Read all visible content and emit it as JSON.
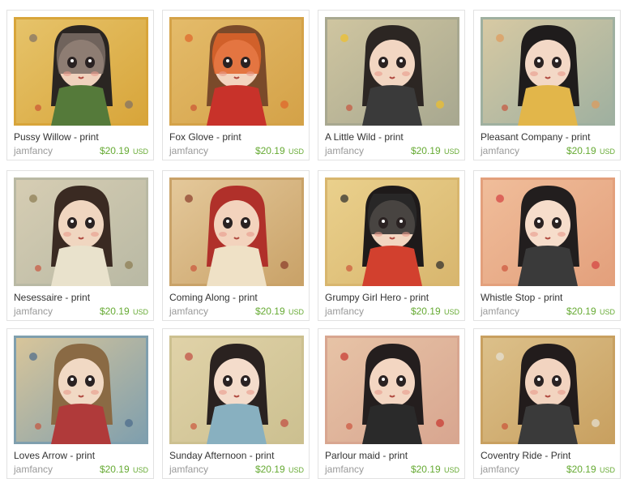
{
  "listings": [
    {
      "title": "Pussy Willow - print",
      "shop": "jamfancy",
      "price": "$20.19",
      "currency": "USD",
      "art": {
        "bg": "#d8a53a",
        "bg2": "#e6c36a",
        "hair": "#2a2522",
        "accent": "#7d6f66",
        "skin": "#f0d2bd",
        "cloth": "#557a3a",
        "mask": true
      }
    },
    {
      "title": "Fox Glove - print",
      "shop": "jamfancy",
      "price": "$20.19",
      "currency": "USD",
      "art": {
        "bg": "#d4a248",
        "bg2": "#e4bb6a",
        "hair": "#7a4a2a",
        "accent": "#e0642a",
        "skin": "#f3d4bf",
        "cloth": "#c8322a",
        "mask": true
      }
    },
    {
      "title": "A Little Wild - print",
      "shop": "jamfancy",
      "price": "$20.19",
      "currency": "USD",
      "art": {
        "bg": "#a8a890",
        "bg2": "#cfc5a0",
        "hair": "#2c2623",
        "accent": "#f0c02a",
        "skin": "#f2d6c2",
        "cloth": "#3a3a3a",
        "mask": false
      }
    },
    {
      "title": "Pleasant Company - print",
      "shop": "jamfancy",
      "price": "$20.19",
      "currency": "USD",
      "art": {
        "bg": "#9fb0a0",
        "bg2": "#d7c9a3",
        "hair": "#1f1c1c",
        "accent": "#e09a5a",
        "skin": "#f3d8c6",
        "cloth": "#e2b64a",
        "mask": false
      }
    },
    {
      "title": "Nesessaire - print",
      "shop": "jamfancy",
      "price": "$20.19",
      "currency": "USD",
      "art": {
        "bg": "#b9b9a4",
        "bg2": "#d6cdb3",
        "hair": "#3a2a22",
        "accent": "#8a7a50",
        "skin": "#f0d6c0",
        "cloth": "#e9e2cc",
        "mask": false
      }
    },
    {
      "title": "Coming Along - print",
      "shop": "jamfancy",
      "price": "$20.19",
      "currency": "USD",
      "art": {
        "bg": "#c9a268",
        "bg2": "#e4c89a",
        "hair": "#b0302a",
        "accent": "#8a3a2a",
        "skin": "#f3d3bd",
        "cloth": "#efe1c6",
        "mask": false
      }
    },
    {
      "title": "Grumpy Girl Hero - print",
      "shop": "jamfancy",
      "price": "$20.19",
      "currency": "USD",
      "art": {
        "bg": "#d8b66e",
        "bg2": "#ead08c",
        "hair": "#1e1a1a",
        "accent": "#2a2a2a",
        "skin": "#f2d6c1",
        "cloth": "#d2402e",
        "mask": true
      }
    },
    {
      "title": "Whistle Stop - print",
      "shop": "jamfancy",
      "price": "$20.19",
      "currency": "USD",
      "art": {
        "bg": "#e3a07c",
        "bg2": "#f0bd9a",
        "hair": "#221e1e",
        "accent": "#d44040",
        "skin": "#f6ddcb",
        "cloth": "#3a3a3a",
        "mask": false
      }
    },
    {
      "title": "Loves Arrow - print",
      "shop": "jamfancy",
      "price": "$20.19",
      "currency": "USD",
      "art": {
        "bg": "#7f9fae",
        "bg2": "#d8c59a",
        "hair": "#8a6a44",
        "accent": "#4a6a8a",
        "skin": "#f1d9c4",
        "cloth": "#b03a3a",
        "mask": false
      }
    },
    {
      "title": "Sunday Afternoon - print",
      "shop": "jamfancy",
      "price": "$20.19",
      "currency": "USD",
      "art": {
        "bg": "#ccc090",
        "bg2": "#e0d2a8",
        "hair": "#2a2220",
        "accent": "#c04a40",
        "skin": "#f4dccb",
        "cloth": "#88b0c0",
        "mask": false
      }
    },
    {
      "title": "Parlour maid - print",
      "shop": "jamfancy",
      "price": "$20.19",
      "currency": "USD",
      "art": {
        "bg": "#d8a690",
        "bg2": "#e7c3a6",
        "hair": "#241e1e",
        "accent": "#c8342e",
        "skin": "#f3d6c2",
        "cloth": "#2a2a2a",
        "mask": false
      }
    },
    {
      "title": "Coventry Ride - Print",
      "shop": "jamfancy",
      "price": "$20.19",
      "currency": "USD",
      "art": {
        "bg": "#c8a060",
        "bg2": "#dcc08a",
        "hair": "#221c1c",
        "accent": "#e6e2d8",
        "skin": "#f2d4c0",
        "cloth": "#3a3a3a",
        "mask": false
      }
    }
  ]
}
